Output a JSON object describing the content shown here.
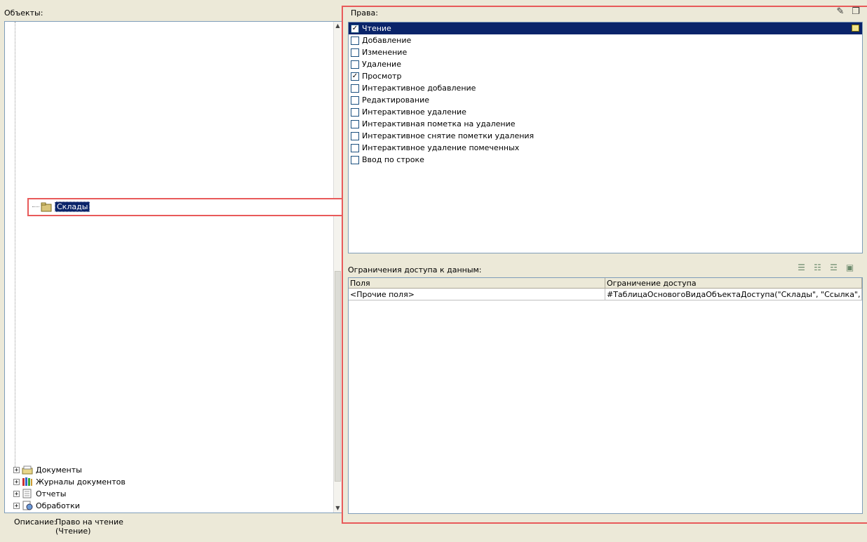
{
  "left_pane": {
    "title": "Объекты:",
    "selected_node": "Склады",
    "tree_nodes": [
      {
        "label": "Документы",
        "icon": "documents-icon"
      },
      {
        "label": "Журналы документов",
        "icon": "document-journals-icon"
      },
      {
        "label": "Отчеты",
        "icon": "reports-icon"
      },
      {
        "label": "Обработки",
        "icon": "data-processors-icon"
      }
    ],
    "expander_glyph": "+"
  },
  "description": {
    "label": "Описание:",
    "line1": "Право на чтение",
    "line2": "(Чтение)"
  },
  "rights": {
    "title": "Права:",
    "items": [
      {
        "label": "Чтение",
        "checked": true,
        "selected": true
      },
      {
        "label": "Добавление",
        "checked": false
      },
      {
        "label": "Изменение",
        "checked": false
      },
      {
        "label": "Удаление",
        "checked": false
      },
      {
        "label": "Просмотр",
        "checked": true
      },
      {
        "label": "Интерактивное добавление",
        "checked": false
      },
      {
        "label": "Редактирование",
        "checked": false
      },
      {
        "label": "Интерактивное удаление",
        "checked": false
      },
      {
        "label": "Интерактивная пометка на удаление",
        "checked": false
      },
      {
        "label": "Интерактивное снятие пометки удаления",
        "checked": false
      },
      {
        "label": "Интерактивное удаление помеченных",
        "checked": false
      },
      {
        "label": "Ввод по строке",
        "checked": false
      }
    ],
    "check_glyph": "✓"
  },
  "restrictions": {
    "title": "Ограничения доступа к данным:",
    "columns": [
      "Поля",
      "Ограничение доступа"
    ],
    "rows": [
      [
        "<Прочие поля>",
        "#ТаблицаОсновогоВидаОбъектаДоступа(\"Склады\", \"Ссылка\", \"\")"
      ]
    ]
  },
  "icons": {
    "top": [
      "edit-restrictions-icon",
      "window-icon"
    ],
    "restrictions_toolbar": [
      "add-row-icon",
      "move-up-icon",
      "delete-row-icon",
      "edit-row-icon"
    ]
  }
}
